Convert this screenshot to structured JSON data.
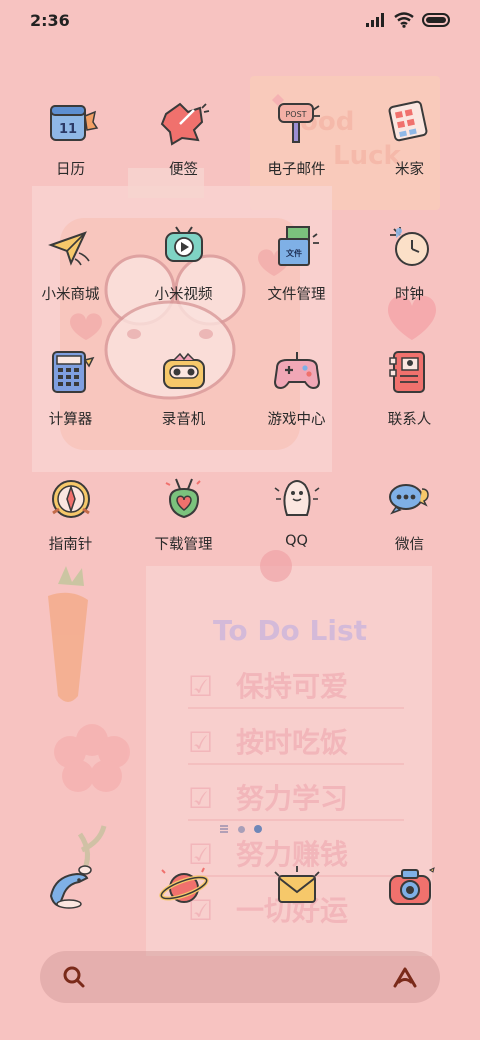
{
  "status_bar": {
    "time": "2:36",
    "icons": [
      "signal-icon",
      "wifi-icon",
      "battery-icon"
    ]
  },
  "wallpaper": {
    "background_color": "#f7c3c1",
    "note_good_luck": "Good Luck",
    "todo_title": "To Do List",
    "todo_items": [
      "保持可爱",
      "按时吃饭",
      "努力学习",
      "努力赚钱",
      "一切好运"
    ]
  },
  "apps": [
    {
      "label": "日历",
      "icon": "calendar-icon"
    },
    {
      "label": "便签",
      "icon": "notes-icon"
    },
    {
      "label": "电子邮件",
      "icon": "email-icon"
    },
    {
      "label": "米家",
      "icon": "mi-home-icon"
    },
    {
      "label": "小米商城",
      "icon": "mi-store-icon"
    },
    {
      "label": "小米视频",
      "icon": "mi-video-icon"
    },
    {
      "label": "文件管理",
      "icon": "file-manager-icon"
    },
    {
      "label": "时钟",
      "icon": "clock-icon"
    },
    {
      "label": "计算器",
      "icon": "calculator-icon"
    },
    {
      "label": "录音机",
      "icon": "recorder-icon"
    },
    {
      "label": "游戏中心",
      "icon": "game-center-icon"
    },
    {
      "label": "联系人",
      "icon": "contacts-icon"
    },
    {
      "label": "指南针",
      "icon": "compass-icon"
    },
    {
      "label": "下载管理",
      "icon": "download-manager-icon"
    },
    {
      "label": "QQ",
      "icon": "qq-icon"
    },
    {
      "label": "微信",
      "icon": "wechat-icon"
    }
  ],
  "page_indicator": {
    "pages": 3,
    "active_page": 3,
    "first_is_list": true
  },
  "dock": [
    {
      "icon": "phone-dolphin-icon"
    },
    {
      "icon": "browser-planet-icon"
    },
    {
      "icon": "messages-envelope-icon"
    },
    {
      "icon": "camera-icon"
    }
  ],
  "search_bar": {
    "left_icon": "search-icon",
    "right_icon": "assistant-icon",
    "accent_color": "#7a2a1a"
  }
}
